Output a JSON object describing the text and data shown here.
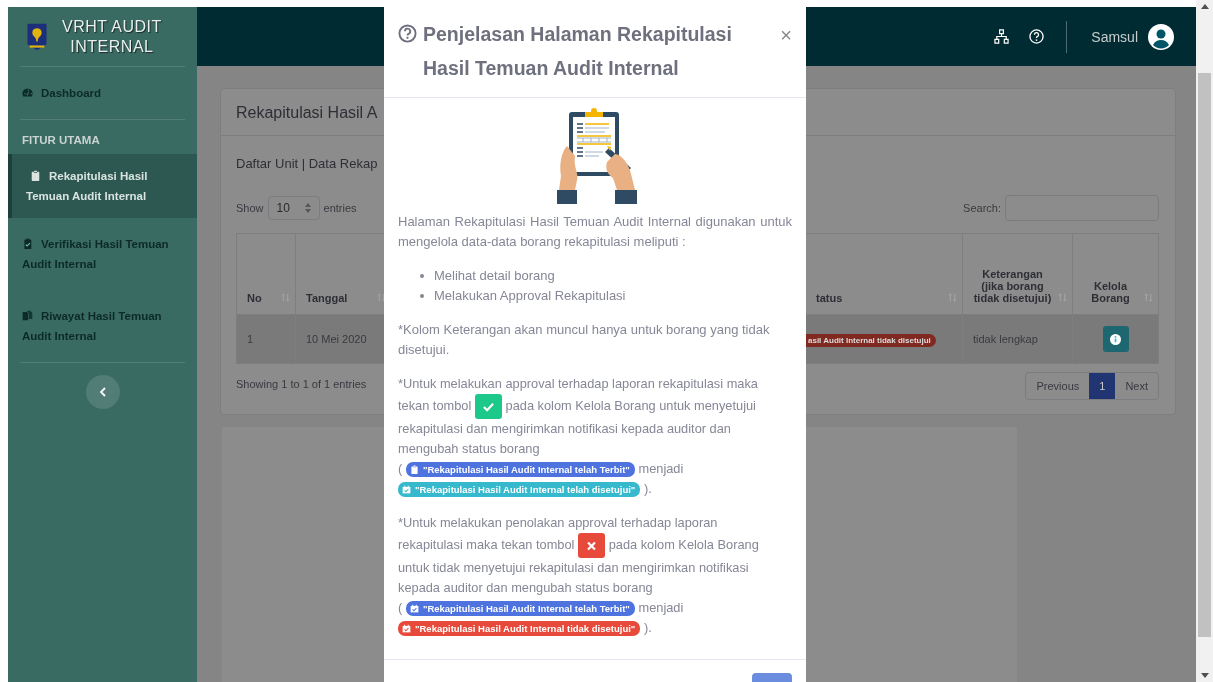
{
  "sidebar": {
    "brand_lines": [
      "VRHT AUDIT",
      "INTERNAL"
    ],
    "top_items": [
      {
        "label": "Dashboard",
        "selected": false
      }
    ],
    "section": {
      "heading": "FITUR UTAMA",
      "items": [
        {
          "label": "Rekapitulasi Hasil Temuan Audit Internal",
          "selected": true
        },
        {
          "label": "Verifikasi Hasil Temuan Audit Internal",
          "selected": false
        },
        {
          "label": "Riwayat Hasil Temuan Audit Internal",
          "selected": false
        }
      ]
    }
  },
  "topbar": {
    "user_name": "Samsul"
  },
  "card": {
    "title": "Rekapitulasi Hasil A",
    "subtitle": "Daftar Unit | Data Rekap",
    "show_label": "Show",
    "length_value": "10",
    "entries_label": "entries",
    "search_label": "Search:",
    "table": {
      "columns": [
        {
          "label": "No"
        },
        {
          "label": "Tanggal"
        },
        {
          "label": "tatus"
        },
        {
          "label": "Keterangan (jika borang tidak disetujui)"
        },
        {
          "label": "Kelola Borang"
        }
      ],
      "rows": [
        {
          "no": "1",
          "tanggal": "10 Mei 2020",
          "status": "asil Audit Internal tidak disetujui",
          "keterangan": "tidak lengkap"
        }
      ]
    },
    "info": "Showing 1 to 1 of 1 entries",
    "pagination": [
      {
        "label": "Previous",
        "selected": false
      },
      {
        "label": "1",
        "selected": true
      },
      {
        "label": "Next",
        "selected": false
      }
    ]
  },
  "modal": {
    "title": "Penjelasan Halaman Rekapitulasi Hasil Temuan Audit Internal",
    "close": "×",
    "intro": "Halaman Rekapitulasi Hasil Temuan Audit Internal digunakan untuk mengelola data-data borang rekapitulasi meliputi :",
    "list": [
      "Melihat detail borang",
      "Melakukan Approval Rekapitulasi"
    ],
    "paragraphs": [
      [
        {
          "kind": "text",
          "text": "*Kolom Keterangan akan muncul hanya untuk borang yang tidak disetujui."
        }
      ],
      [
        {
          "kind": "text",
          "text": "*Untuk melakukan approval terhadap laporan rekapitulasi maka"
        },
        {
          "kind": "break"
        },
        {
          "kind": "text",
          "text": "tekan tombol"
        },
        {
          "kind": "approve"
        },
        {
          "kind": "text",
          "text": "pada kolom Kelola Borang untuk menyetujui"
        },
        {
          "kind": "break"
        },
        {
          "kind": "text",
          "text": "rekapitulasi dan mengirimkan notifikasi kepada auditor dan"
        },
        {
          "kind": "break"
        },
        {
          "kind": "text",
          "text": "mengubah status borang"
        },
        {
          "kind": "break"
        },
        {
          "kind": "text",
          "text": "("
        },
        {
          "kind": "badge",
          "text": "\"Rekapitulasi Hasil Audit Internal telah Terbit\"",
          "color": "#4e73df"
        },
        {
          "kind": "text",
          "text": "menjadi"
        },
        {
          "kind": "badge",
          "text": "\"Rekapitulasi Hasil Audit Internal telah disetujui\"",
          "color": "#36b9cc"
        },
        {
          "kind": "text",
          "text": ")."
        }
      ],
      [
        {
          "kind": "text",
          "text": "*Untuk melakukan penolakan approval terhadap laporan"
        },
        {
          "kind": "break"
        },
        {
          "kind": "text",
          "text": "rekapitulasi maka tekan tombol"
        },
        {
          "kind": "reject"
        },
        {
          "kind": "text",
          "text": "pada kolom Kelola Borang"
        },
        {
          "kind": "break"
        },
        {
          "kind": "text",
          "text": "untuk tidak menyetujui rekapitulasi dan mengirimkan notifikasi"
        },
        {
          "kind": "break"
        },
        {
          "kind": "text",
          "text": "kepada auditor dan mengubah status borang"
        },
        {
          "kind": "break"
        },
        {
          "kind": "text",
          "text": "("
        },
        {
          "kind": "badge",
          "text": "\"Rekapitulasi Hasil Audit Internal telah Terbit\"",
          "color": "#4e73df"
        },
        {
          "kind": "text",
          "text": "menjadi"
        },
        {
          "kind": "badge",
          "text": "\"Rekapitulasi Hasil Audit Internal tidak disetujui\"",
          "color": "#e74a3b"
        },
        {
          "kind": "text",
          "text": ")."
        }
      ]
    ]
  }
}
